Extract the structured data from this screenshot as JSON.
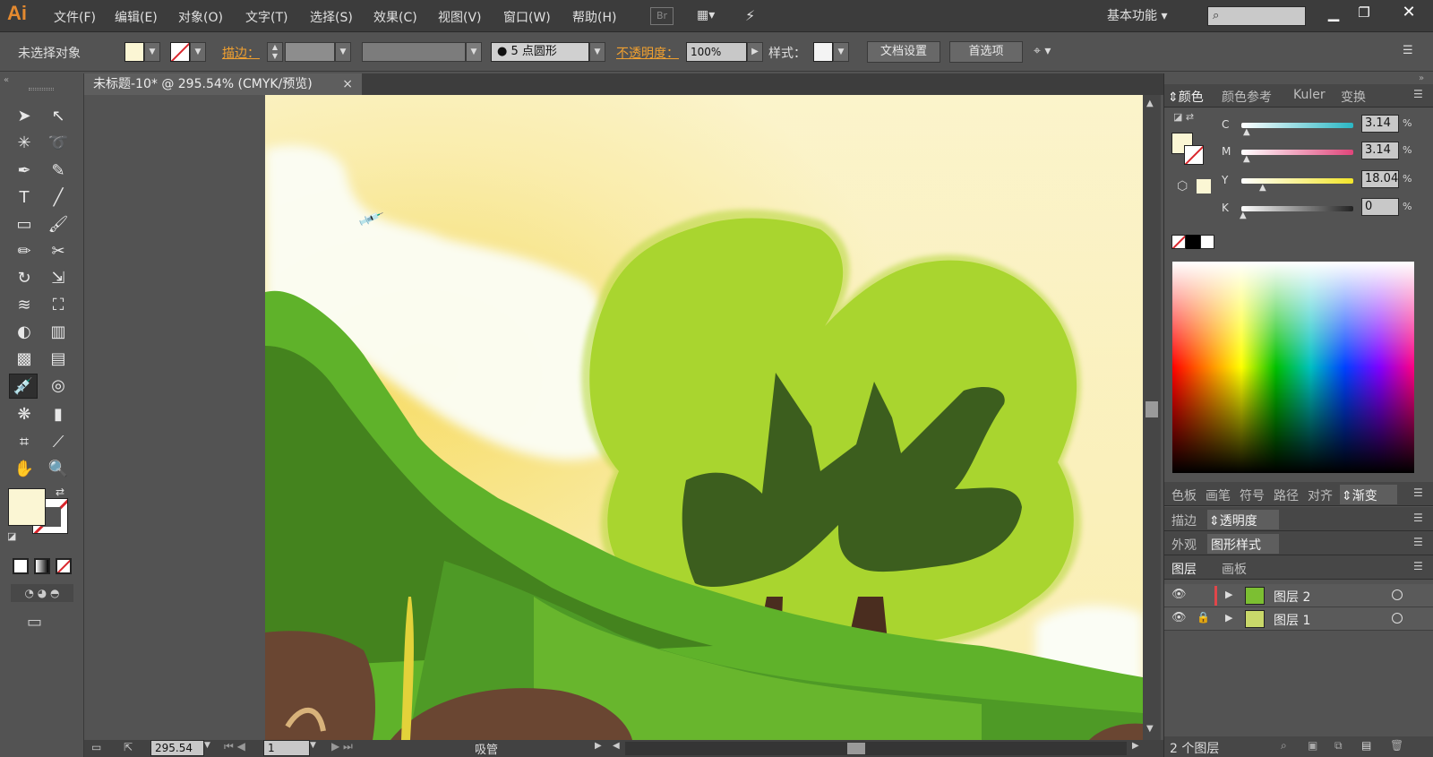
{
  "app": {
    "logo": "Ai",
    "workspace": "基本功能",
    "br_label": "Br"
  },
  "menu": [
    "文件(F)",
    "编辑(E)",
    "对象(O)",
    "文字(T)",
    "选择(S)",
    "效果(C)",
    "视图(V)",
    "窗口(W)",
    "帮助(H)"
  ],
  "control_bar": {
    "selection_status": "未选择对象",
    "stroke_label": "描边：",
    "brush_label": "5 点圆形",
    "opacity_label": "不透明度：",
    "opacity_value": "100%",
    "style_label": "样式：",
    "doc_setup_button": "文档设置",
    "prefs_button": "首选项"
  },
  "document": {
    "tab_title": "未标题-10* @ 295.54% (CMYK/预览)",
    "close": "×"
  },
  "status": {
    "zoom": "295.54",
    "artboard": "1",
    "tool": "吸管"
  },
  "color_panel": {
    "tabs": [
      "颜色",
      "颜色参考",
      "Kuler",
      "变换"
    ],
    "channels": [
      {
        "name": "C",
        "value": "3.14",
        "pct": 0.0314,
        "color": "#2ab7c4"
      },
      {
        "name": "M",
        "value": "3.14",
        "pct": 0.0314,
        "color": "#e0457a"
      },
      {
        "name": "Y",
        "value": "18.04",
        "pct": 0.1804,
        "color": "#f2e52a"
      },
      {
        "name": "K",
        "value": "0",
        "pct": 0,
        "color": "#222222"
      }
    ],
    "percent": "%"
  },
  "panel_groups": {
    "row1": [
      "色板",
      "画笔",
      "符号",
      "路径",
      "对齐",
      "渐变"
    ],
    "row2": [
      "描边",
      "透明度"
    ],
    "row3": [
      "外观",
      "图形样式"
    ],
    "row4": [
      "图层",
      "画板"
    ]
  },
  "layers": [
    {
      "name": "图层 2"
    },
    {
      "name": "图层 1"
    }
  ],
  "layers_footer": "2 个图层",
  "colors": {
    "fill": "#fbf6d4",
    "accent": "#e58a2f"
  }
}
